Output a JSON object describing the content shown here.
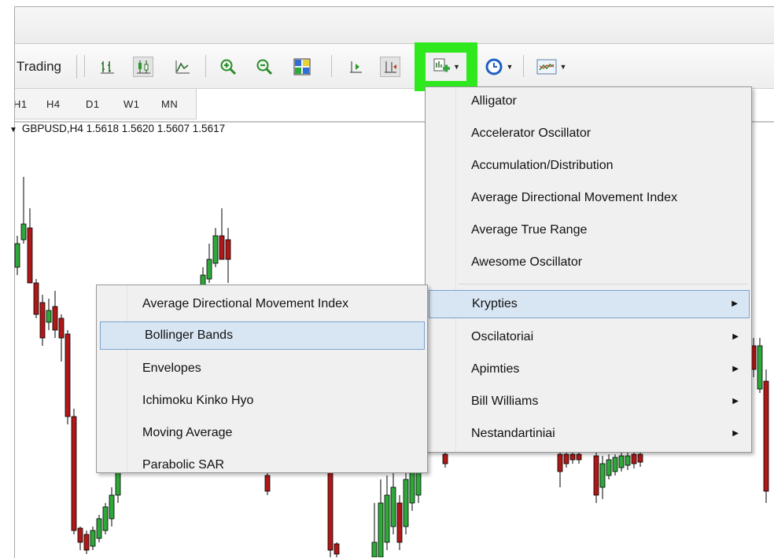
{
  "toolbar": {
    "trading_label": "Trading",
    "icons": [
      "bar-chart-icon",
      "candlestick-icon",
      "line-chart-icon",
      "zoom-in-icon",
      "zoom-out-icon",
      "tile-windows-icon",
      "chart-shift-icon",
      "autoscroll-icon",
      "indicators-icon",
      "periods-icon",
      "templates-icon"
    ],
    "highlight_color": "#2fe81e"
  },
  "timeframes": [
    "H1",
    "H4",
    "D1",
    "W1",
    "MN"
  ],
  "chart": {
    "symbol_info": "GBPUSD,H4  1.5618 1.5620 1.5607 1.5617"
  },
  "indicators_menu": {
    "items": [
      "Alligator",
      "Accelerator Oscillator",
      "Accumulation/Distribution",
      "Average Directional Movement Index",
      "Average True Range",
      "Awesome Oscillator"
    ],
    "submenus": [
      "Krypties",
      "Oscilatoriai",
      "Apimties",
      "Bill Williams",
      "Nestandartiniai"
    ],
    "active_submenu": "Krypties"
  },
  "trend_submenu": {
    "items": [
      "Average Directional Movement Index",
      "Bollinger Bands",
      "Envelopes",
      "Ichimoku Kinko Hyo",
      "Moving Average",
      "Parabolic SAR"
    ],
    "selected": "Bollinger Bands"
  }
}
